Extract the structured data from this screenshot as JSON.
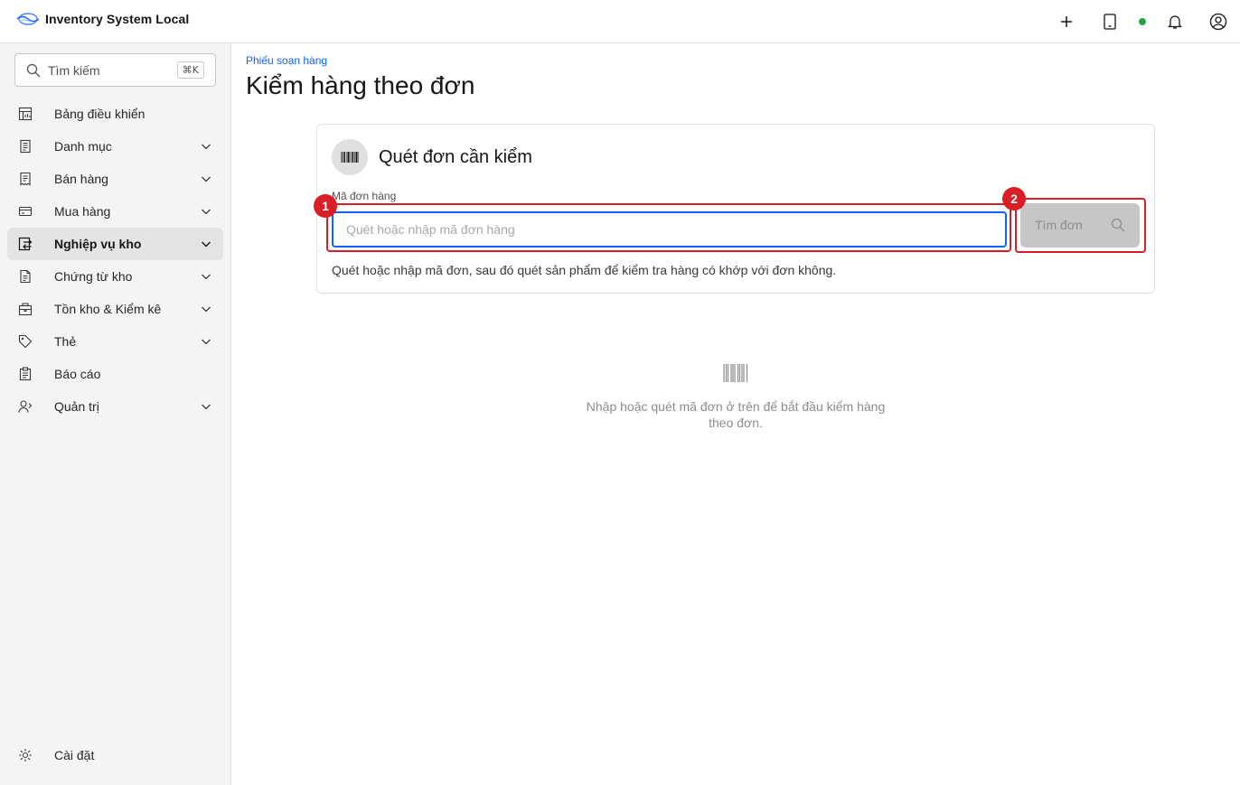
{
  "header": {
    "app_title": "Inventory System Local",
    "icons": [
      "plus-icon",
      "tablet-icon",
      "status-dot",
      "bell-icon",
      "user-icon"
    ],
    "status_color": "#24a148"
  },
  "sidebar": {
    "search_placeholder": "Tìm kiếm",
    "search_shortcut": "⌘K",
    "items": [
      {
        "label": "Bảng điều khiển",
        "icon": "dashboard-icon",
        "expandable": false
      },
      {
        "label": "Danh mục",
        "icon": "catalog-icon",
        "expandable": true
      },
      {
        "label": "Bán hàng",
        "icon": "receipt-icon",
        "expandable": true
      },
      {
        "label": "Mua hàng",
        "icon": "card-icon",
        "expandable": true
      },
      {
        "label": "Nghiệp vụ kho",
        "icon": "warehouse-ops-icon",
        "expandable": true,
        "active": true
      },
      {
        "label": "Chứng từ kho",
        "icon": "document-icon",
        "expandable": true
      },
      {
        "label": "Tồn kho & Kiểm kê",
        "icon": "inventory-icon",
        "expandable": true
      },
      {
        "label": "Thẻ",
        "icon": "tag-icon",
        "expandable": true
      },
      {
        "label": "Báo cáo",
        "icon": "report-icon",
        "expandable": false
      },
      {
        "label": "Quản trị",
        "icon": "admin-icon",
        "expandable": true
      }
    ],
    "settings_label": "Cài đặt"
  },
  "main": {
    "breadcrumb": "Phiếu soạn hàng",
    "title": "Kiểm hàng theo đơn",
    "card": {
      "title": "Quét đơn cần kiểm",
      "field_label": "Mã đơn hàng",
      "input_placeholder": "Quét hoặc nhập mã đơn hàng",
      "input_value": "",
      "button_label": "Tìm đơn",
      "helper_text": "Quét hoặc nhập mã đơn, sau đó quét sản phẩm để kiểm tra hàng có khớp với đơn không."
    },
    "empty_state": {
      "line1": "Nhập hoặc quét mã đơn ở trên để bắt đầu kiểm hàng",
      "line2": "theo đơn."
    }
  },
  "annotations": {
    "badge_1": "1",
    "badge_2": "2",
    "highlight_color": "#da1e28"
  },
  "colors": {
    "accent": "#0f62fe",
    "sidebar_bg": "#f4f4f4",
    "active_item_bg": "#e4e4e4",
    "button_disabled_bg": "#c6c6c6"
  }
}
